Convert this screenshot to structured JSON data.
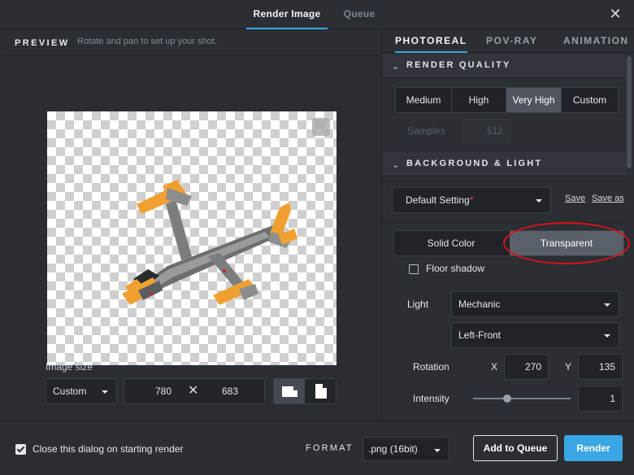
{
  "header": {
    "tabs": [
      {
        "label": "Render Image",
        "active": true
      },
      {
        "label": "Queue",
        "active": false
      }
    ],
    "close_icon": "close-icon"
  },
  "preview": {
    "title": "PREVIEW",
    "subtitle": "Rotate and pan to set up your shot.",
    "image_size_label": "Image size",
    "size_preset": "Custom",
    "width": "780",
    "times": "✕",
    "height": "683",
    "orientation_options": [
      "landscape-icon",
      "portrait-icon"
    ]
  },
  "settings": {
    "tabs": [
      {
        "label": "PHOTOREAL",
        "active": true
      },
      {
        "label": "POV-RAY",
        "active": false
      },
      {
        "label": "ANIMATION",
        "active": false
      }
    ],
    "render_quality": {
      "title": "RENDER QUALITY",
      "options": [
        "Medium",
        "High",
        "Very High",
        "Custom"
      ],
      "selected": "Very High",
      "samples_label": "Samples",
      "samples_value": "512"
    },
    "background_light": {
      "title": "BACKGROUND & LIGHT",
      "preset": "Default Setting",
      "modified_mark": "*",
      "save_label": "Save",
      "save_as_label": "Save as",
      "bg_options": [
        "Solid Color",
        "Transparent"
      ],
      "bg_selected": "Transparent",
      "floor_shadow_label": "Floor shadow",
      "floor_shadow_checked": false,
      "light_label": "Light",
      "light_preset": "Mechanic",
      "light_direction": "Left-Front",
      "rotation_label": "Rotation",
      "rotation_x_label": "X",
      "rotation_x": "270",
      "rotation_y_label": "Y",
      "rotation_y": "135",
      "intensity_label": "Intensity",
      "intensity_value": "1",
      "intensity_slider_fraction": 0.35
    }
  },
  "footer": {
    "close_on_render_label": "Close this dialog on starting render",
    "close_on_render_checked": true,
    "format_label": "FORMAT",
    "format_value": ".png (16bit)",
    "add_to_queue_label": "Add to Queue",
    "render_label": "Render"
  },
  "colors": {
    "accent": "#3aa6e3",
    "highlight_circle": "#d8121b",
    "panel_bg": "#2b2e33"
  }
}
